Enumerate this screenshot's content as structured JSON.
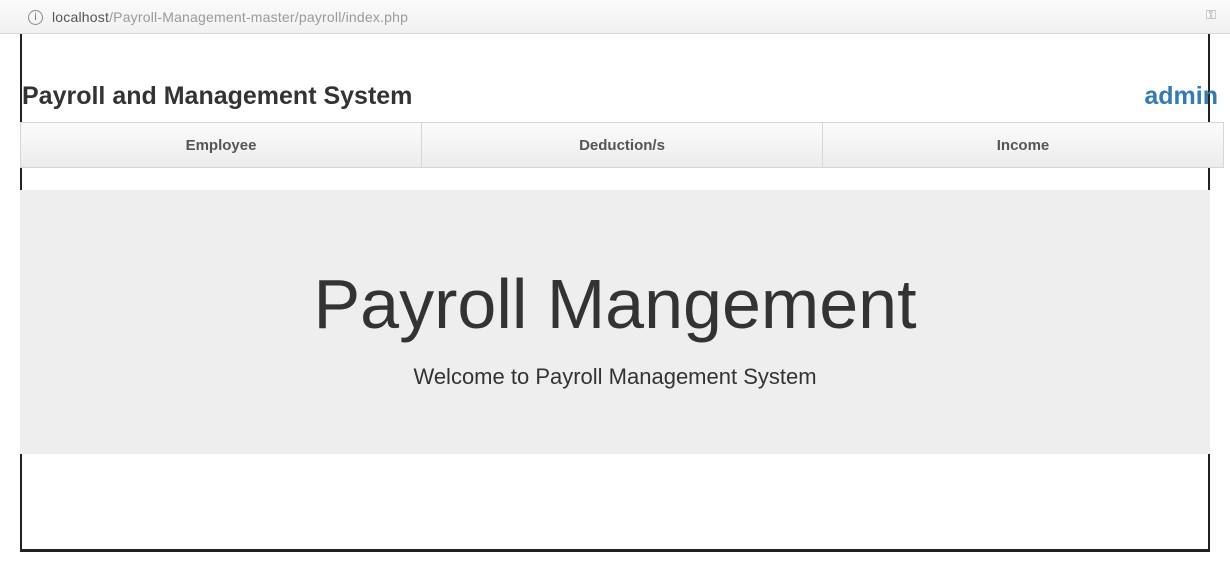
{
  "browser": {
    "url_host": "localhost",
    "url_path": "/Payroll-Management-master/payroll/index.php",
    "info_icon": "info-icon",
    "key_icon": "key-icon"
  },
  "header": {
    "title": "Payroll and Management System",
    "user": "admin"
  },
  "nav": {
    "items": [
      {
        "label": "Employee"
      },
      {
        "label": "Deduction/s"
      },
      {
        "label": "Income"
      }
    ]
  },
  "jumbotron": {
    "title": "Payroll Mangement",
    "subtitle": "Welcome to Payroll Management System"
  },
  "colors": {
    "link": "#337ab7",
    "jumbotron_bg": "#eeeeee",
    "text": "#333333"
  }
}
